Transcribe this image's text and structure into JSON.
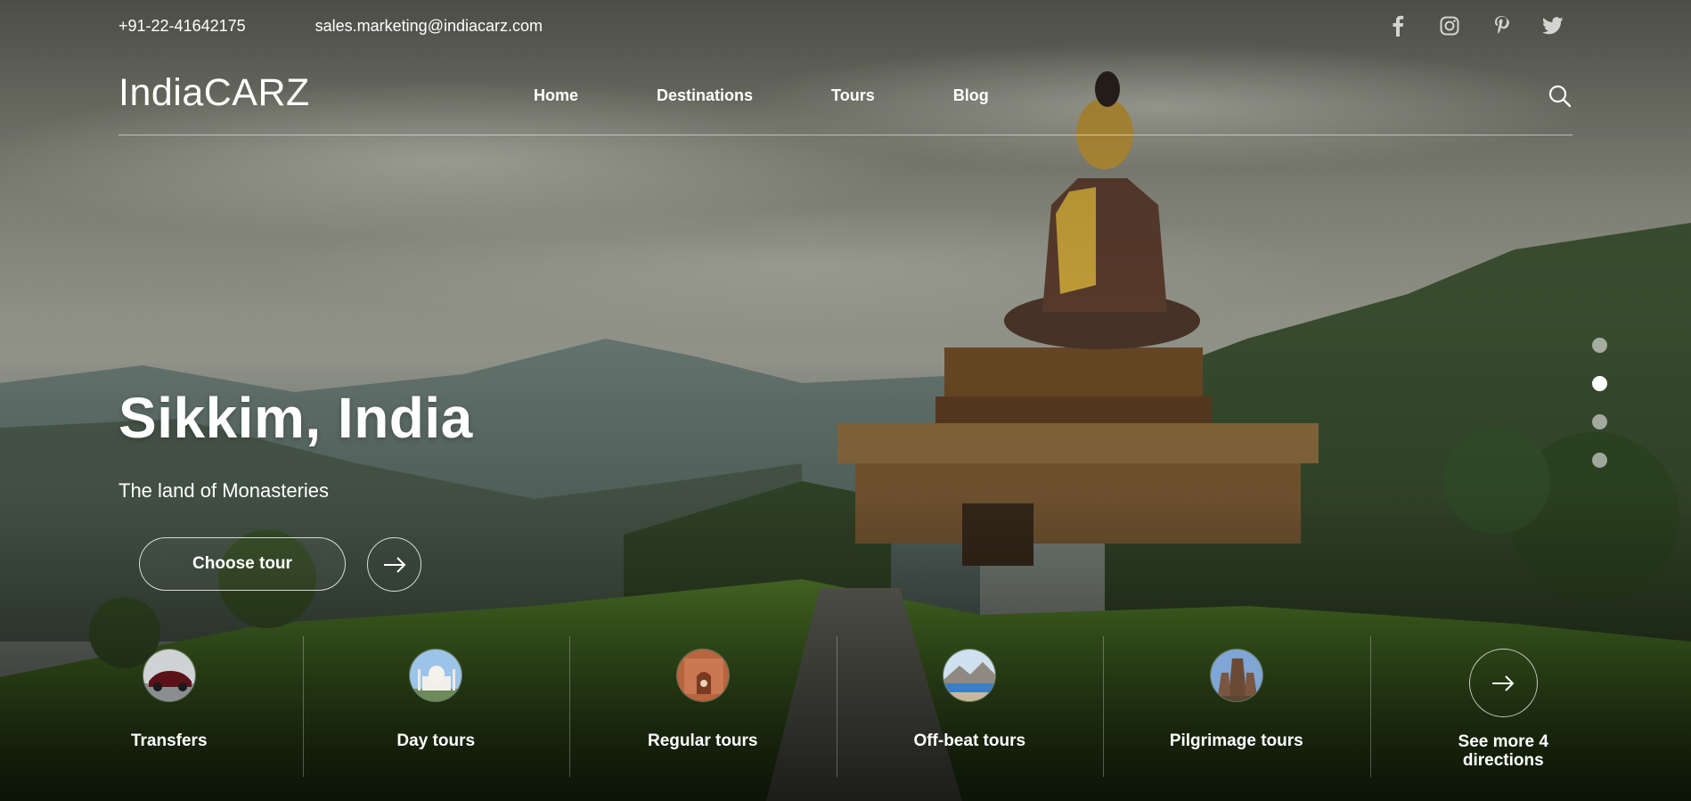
{
  "topbar": {
    "phone": "+91-22-41642175",
    "email": "sales.marketing@indiacarz.com",
    "socials": [
      "facebook-icon",
      "instagram-icon",
      "pinterest-icon",
      "twitter-icon"
    ]
  },
  "header": {
    "logo": "IndiaCARZ",
    "nav": [
      "Home",
      "Destinations",
      "Tours",
      "Blog"
    ],
    "search_icon": "search-icon"
  },
  "hero": {
    "title": "Sikkim, India",
    "subtitle": "The land of Monasteries",
    "cta_label": "Choose tour",
    "cta_arrow_icon": "arrow-right-icon"
  },
  "slider": {
    "dot_count": 4,
    "active_dot": 2
  },
  "categories": [
    {
      "label": "Transfers",
      "thumb": "car-thumbnail"
    },
    {
      "label": "Day tours",
      "thumb": "taj-mahal-thumbnail"
    },
    {
      "label": "Regular tours",
      "thumb": "fort-thumbnail"
    },
    {
      "label": "Off-beat tours",
      "thumb": "mountain-lake-thumbnail"
    },
    {
      "label": "Pilgrimage tours",
      "thumb": "temple-thumbnail"
    }
  ],
  "see_more": {
    "label": "See more 4 directions",
    "icon": "arrow-right-icon"
  },
  "colors": {
    "text": "#ffffff",
    "overlay": "#000000"
  }
}
